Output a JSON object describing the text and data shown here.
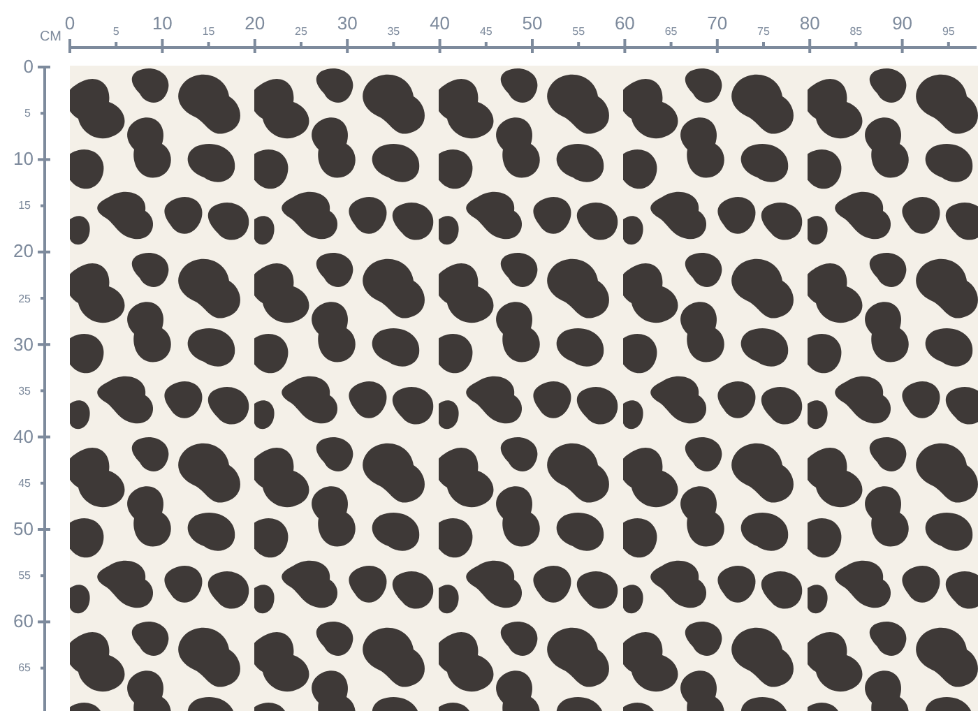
{
  "ruler": {
    "unit": "CM",
    "horizontal": [
      {
        "label": "0",
        "kind": "major"
      },
      {
        "label": "5",
        "kind": "minor"
      },
      {
        "label": "10",
        "kind": "major"
      },
      {
        "label": "15",
        "kind": "minor"
      },
      {
        "label": "20",
        "kind": "major"
      },
      {
        "label": "25",
        "kind": "minor"
      },
      {
        "label": "30",
        "kind": "major"
      },
      {
        "label": "35",
        "kind": "minor"
      },
      {
        "label": "40",
        "kind": "major"
      },
      {
        "label": "45",
        "kind": "minor"
      },
      {
        "label": "50",
        "kind": "major"
      },
      {
        "label": "55",
        "kind": "minor"
      },
      {
        "label": "60",
        "kind": "major"
      },
      {
        "label": "65",
        "kind": "minor"
      },
      {
        "label": "70",
        "kind": "major"
      },
      {
        "label": "75",
        "kind": "minor"
      },
      {
        "label": "80",
        "kind": "major"
      },
      {
        "label": "85",
        "kind": "minor"
      },
      {
        "label": "90",
        "kind": "major"
      },
      {
        "label": "95",
        "kind": "minor"
      }
    ],
    "vertical": [
      {
        "label": "0",
        "kind": "major"
      },
      {
        "label": "5",
        "kind": "minor"
      },
      {
        "label": "10",
        "kind": "major"
      },
      {
        "label": "15",
        "kind": "minor"
      },
      {
        "label": "20",
        "kind": "major"
      },
      {
        "label": "25",
        "kind": "minor"
      },
      {
        "label": "30",
        "kind": "major"
      },
      {
        "label": "35",
        "kind": "minor"
      },
      {
        "label": "40",
        "kind": "major"
      },
      {
        "label": "45",
        "kind": "minor"
      },
      {
        "label": "50",
        "kind": "major"
      },
      {
        "label": "55",
        "kind": "minor"
      },
      {
        "label": "60",
        "kind": "major"
      },
      {
        "label": "65",
        "kind": "minor"
      }
    ]
  }
}
